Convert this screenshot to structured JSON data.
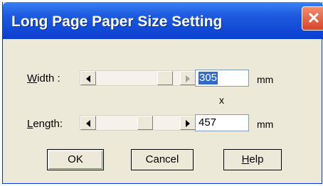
{
  "dialog": {
    "title": "Long Page Paper Size Setting",
    "close_glyph": "✕"
  },
  "width": {
    "label_underlined": "W",
    "label_rest": "idth :",
    "value": "305",
    "unit": "mm",
    "slider_level_fraction": 0.9
  },
  "separator": "x",
  "length": {
    "label_underlined": "L",
    "label_rest": "ength:",
    "value": "457",
    "unit": "mm",
    "slider_level_fraction": 0.6
  },
  "buttons": {
    "ok": "OK",
    "cancel": "Cancel",
    "help_underlined": "H",
    "help_rest": "elp"
  },
  "colors": {
    "titlebar": "#0a3fcf",
    "face": "#ece9d8",
    "selection": "#316ac5"
  }
}
